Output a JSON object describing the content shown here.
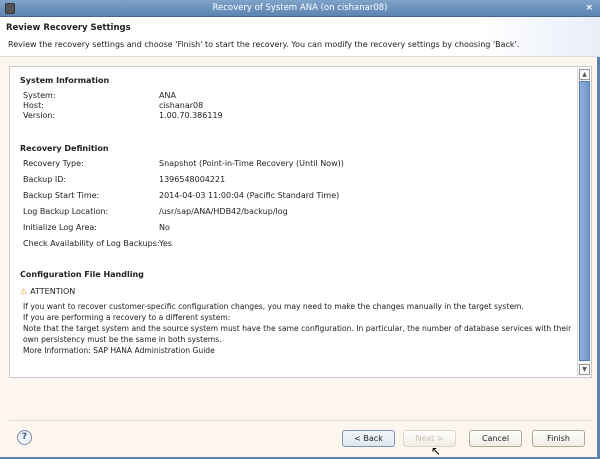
{
  "window": {
    "title": "Recovery of System ANA  (on cishanar08)",
    "close": "×"
  },
  "header": {
    "title": "Review Recovery Settings",
    "description": "Review the recovery settings and choose 'Finish' to start the recovery. You can modify the recovery settings by choosing 'Back'."
  },
  "system_info": {
    "heading": "System Information",
    "rows": [
      {
        "label": "System:",
        "value": "ANA"
      },
      {
        "label": "Host:",
        "value": "cishanar08"
      },
      {
        "label": "Version:",
        "value": "1.00.70.386119"
      }
    ]
  },
  "recovery_def": {
    "heading": "Recovery Definition",
    "rows": [
      {
        "label": "Recovery Type:",
        "value": "Snapshot (Point-in-Time Recovery (Until Now))"
      },
      {
        "label": "Backup ID:",
        "value": "1396548004221"
      },
      {
        "label": "Backup Start Time:",
        "value": "2014-04-03 11:00:04 (Pacific Standard Time)"
      },
      {
        "label": "Log Backup Location:",
        "value": "/usr/sap/ANA/HDB42/backup/log"
      },
      {
        "label": "Initialize Log Area:",
        "value": "No"
      },
      {
        "label": "Check Availability of Log Backups:",
        "value": "Yes"
      }
    ]
  },
  "config": {
    "heading": "Configuration File Handling",
    "attention": "ATTENTION",
    "lines": [
      "If you want to recover customer-specific configuration changes, you may need to make the changes manually in the target system.",
      "If you are performing a recovery to a different system:",
      "Note that the target system and the source system must have the same configuration. In particular, the number of database services with their",
      "own persistency must be the same in both systems.",
      "More Information: SAP HANA Administration Guide"
    ]
  },
  "buttons": {
    "help": "?",
    "back": "< Back",
    "next": "Next >",
    "cancel": "Cancel",
    "finish": "Finish"
  }
}
